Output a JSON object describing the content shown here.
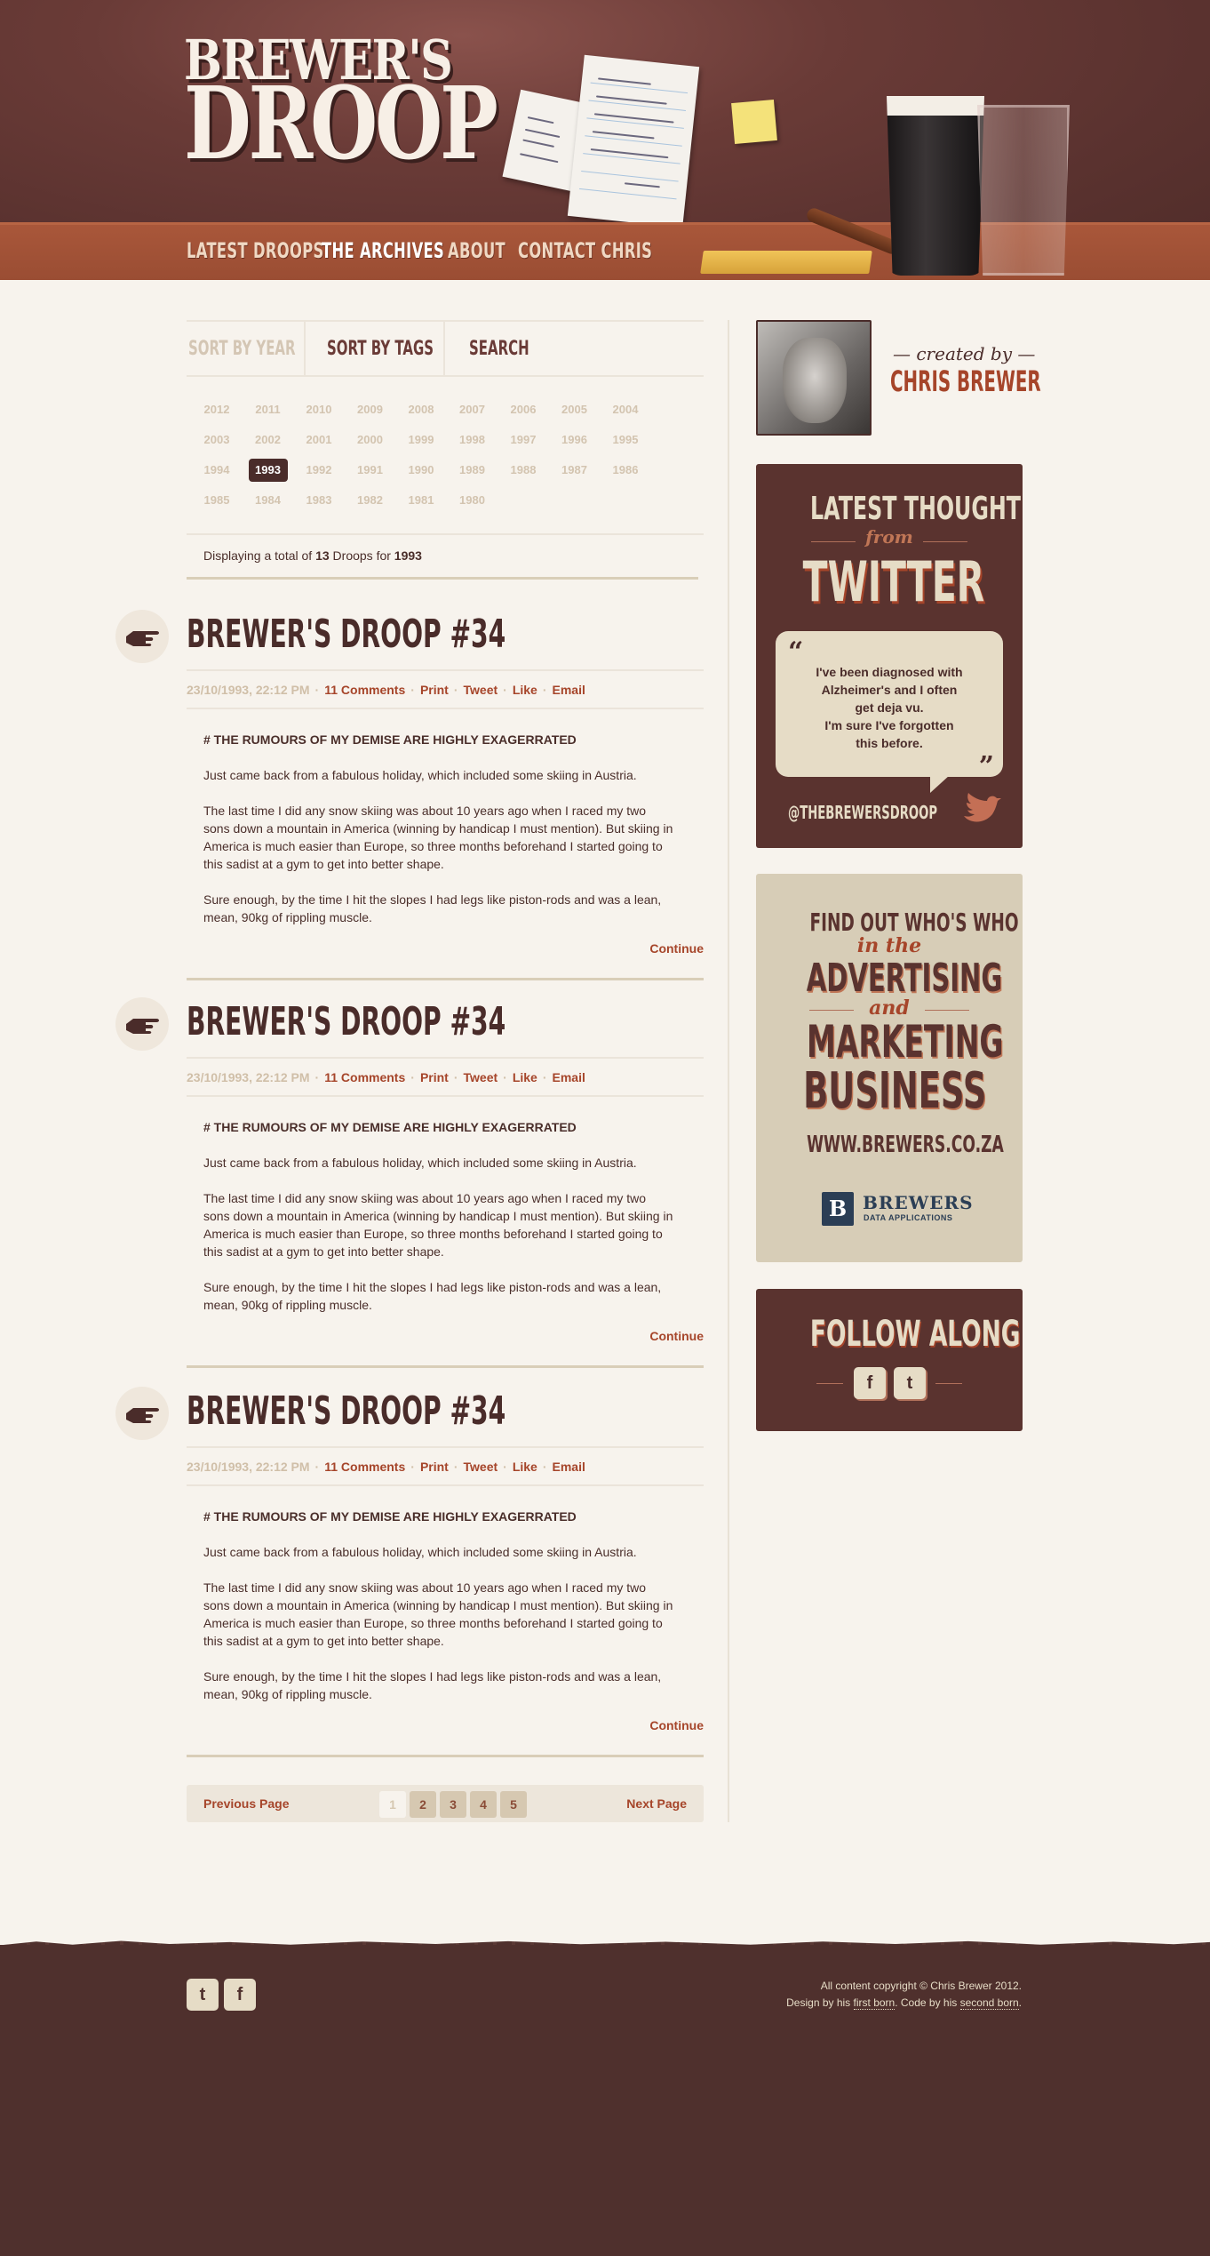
{
  "logo": {
    "line1": "BREWER'S",
    "line2": "DROOP"
  },
  "nav": [
    {
      "label": "LATEST DROOPS"
    },
    {
      "label": "THE ARCHIVES"
    },
    {
      "label": "ABOUT"
    },
    {
      "label": "CONTACT CHRIS"
    }
  ],
  "sort": {
    "by_year": "SORT BY YEAR",
    "by_tags": "SORT BY TAGS",
    "search": "SEARCH"
  },
  "years": {
    "row1": [
      "2012",
      "2011",
      "2010",
      "2009",
      "2008",
      "2007",
      "2006",
      "2005",
      "2004"
    ],
    "row2": [
      "2003",
      "2002",
      "2001",
      "2000",
      "1999",
      "1998",
      "1997",
      "1996",
      "1995"
    ],
    "row3": [
      "1994",
      "1993",
      "1992",
      "1991",
      "1990",
      "1989",
      "1988",
      "1987",
      "1986"
    ],
    "row4": [
      "1985",
      "1984",
      "1983",
      "1982",
      "1981",
      "1980"
    ],
    "selected": "1993"
  },
  "total": {
    "prefix": "Displaying a total of",
    "count": "13",
    "middle": "Droops for",
    "year": "1993"
  },
  "posts": [
    {
      "title": "BREWER'S DROOP #34",
      "date": "23/10/1993, 22:12 PM",
      "comments": "11 Comments",
      "print": "Print",
      "tweet": "Tweet",
      "like": "Like",
      "email": "Email",
      "heading": "# THE RUMOURS OF MY DEMISE ARE HIGHLY EXAGERRATED",
      "p1": "Just came back from a fabulous holiday, which included some skiing in Austria.",
      "p2": "The last time I did any snow skiing was about 10 years ago when I raced my two sons down a mountain in America (winning by handicap I must mention). But skiing in America is much easier than Europe, so three months beforehand I started going to this sadist at a gym to get into better shape.",
      "p3": "Sure enough, by the time I hit the slopes I had legs like piston-rods and was a lean, mean, 90kg of rippling muscle.",
      "continue": "Continue"
    },
    {
      "title": "BREWER'S DROOP #34",
      "date": "23/10/1993, 22:12 PM",
      "comments": "11 Comments",
      "print": "Print",
      "tweet": "Tweet",
      "like": "Like",
      "email": "Email",
      "heading": "# THE RUMOURS OF MY DEMISE ARE HIGHLY EXAGERRATED",
      "p1": "Just came back from a fabulous holiday, which included some skiing in Austria.",
      "p2": "The last time I did any snow skiing was about 10 years ago when I raced my two sons down a mountain in America (winning by handicap I must mention). But skiing in America is much easier than Europe, so three months beforehand I started going to this sadist at a gym to get into better shape.",
      "p3": "Sure enough, by the time I hit the slopes I had legs like piston-rods and was a lean, mean, 90kg of rippling muscle.",
      "continue": "Continue"
    },
    {
      "title": "BREWER'S DROOP #34",
      "date": "23/10/1993, 22:12 PM",
      "comments": "11 Comments",
      "print": "Print",
      "tweet": "Tweet",
      "like": "Like",
      "email": "Email",
      "heading": "# THE RUMOURS OF MY DEMISE ARE HIGHLY EXAGERRATED",
      "p1": "Just came back from a fabulous holiday, which included some skiing in Austria.",
      "p2": "The last time I did any snow skiing was about 10 years ago when I raced my two sons down a mountain in America (winning by handicap I must mention). But skiing in America is much easier than Europe, so three months beforehand I started going to this sadist at a gym to get into better shape.",
      "p3": "Sure enough, by the time I hit the slopes I had legs like piston-rods and was a lean, mean, 90kg of rippling muscle.",
      "continue": "Continue"
    }
  ],
  "pager": {
    "prev": "Previous Page",
    "next": "Next Page",
    "pages": [
      "1",
      "2",
      "3",
      "4",
      "5"
    ],
    "current": "1"
  },
  "author": {
    "created_by": "created by",
    "name": "CHRIS BREWER"
  },
  "twitter_box": {
    "line1": "LATEST THOUGHT",
    "line2": "from",
    "line3": "TWITTER",
    "tweet_l1": "I've been diagnosed with",
    "tweet_l2": "Alzheimer's and I often",
    "tweet_l3": "get deja vu.",
    "tweet_l4": "I'm sure I've forgotten",
    "tweet_l5": "this before.",
    "handle": "@THEBREWERSDROOP"
  },
  "ad_box": {
    "line1": "FIND OUT WHO'S WHO",
    "line2": "in the",
    "line3": "ADVERTISING",
    "line4": "and",
    "line5": "MARKETING",
    "line6": "BUSINESS",
    "url": "WWW.BREWERS.CO.ZA",
    "logo_letter": "B",
    "logo_name": "BREWERS",
    "logo_sub": "DATA APPLICATIONS"
  },
  "follow_box": {
    "title": "FOLLOW ALONG"
  },
  "footer": {
    "copyright": "All content copyright © Chris Brewer 2012.",
    "design_prefix": "Design by his",
    "design_link": "first born",
    "code_prefix": ". Code by his",
    "code_link": "second born",
    "code_suffix": "."
  },
  "colors": {
    "header_bg": "#5a322f",
    "nav_band": "#a9573a",
    "accent": "#a6452a",
    "page_bg": "#f7f3ed",
    "dark_box": "#5a332f",
    "cream": "#e6dcc6",
    "ad_bg": "#d7cdb7"
  },
  "icons": {
    "pointing_hand": "pointing-hand-icon",
    "twitter": "twitter-bird-icon",
    "facebook": "facebook-icon"
  }
}
